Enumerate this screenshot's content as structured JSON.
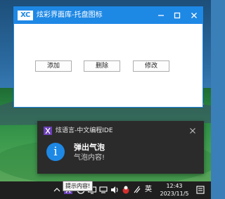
{
  "window": {
    "logo_text": "XC",
    "title": "炫彩界面库-托盘图标",
    "buttons": {
      "add": "添加",
      "delete": "删除",
      "modify": "修改"
    }
  },
  "notification": {
    "app_name": "炫语言-中文编程IDE",
    "title": "弹出气泡",
    "body": "气泡内容!"
  },
  "tooltip": {
    "text": "提示内容!"
  },
  "taskbar": {
    "ime": "英",
    "time": "12:43",
    "date": "2023/11/5"
  },
  "colors": {
    "accent": "#1e88e5",
    "toast_background": "#2b2b2b",
    "taskbar": "#1f1f1f"
  }
}
